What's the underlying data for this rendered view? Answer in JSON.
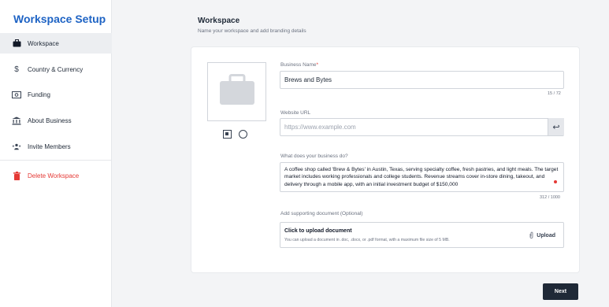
{
  "sidebar": {
    "brand": "Workspace Setup",
    "items": [
      {
        "label": "Workspace",
        "icon": "briefcase-icon"
      },
      {
        "label": "Country & Currency",
        "icon": "dollar-icon"
      },
      {
        "label": "Funding",
        "icon": "banknote-icon"
      },
      {
        "label": "About Business",
        "icon": "bank-icon"
      },
      {
        "label": "Invite Members",
        "icon": "users-icon"
      }
    ],
    "delete_label": "Delete Workspace"
  },
  "main": {
    "title": "Workspace",
    "subtitle": "Name your workspace and add branding details"
  },
  "form": {
    "business_name": {
      "label": "Business Name",
      "required_mark": "*",
      "value": "Brews and Bytes",
      "counter": "15 / 72"
    },
    "website": {
      "label": "Website URL",
      "placeholder": "https://www.example.com"
    },
    "description": {
      "label": "What does your business do?",
      "value": "A coffee shop called 'Brew & Bytes' in Austin, Texas, serving specialty coffee, fresh pastries, and light meals. The target market includes working professionals and college students. Revenue streams cover in-store dining, takeout, and delivery through a mobile app, with an initial investment budget of $150,000",
      "counter": "312 / 1000"
    },
    "document": {
      "label": "Add supporting document (Optional)",
      "title": "Click to upload document",
      "hint": "You can upload a document in .doc, .docx, or .pdf format, with a maximum file size of 5 MB.",
      "button": "Upload"
    }
  },
  "next_label": "Next",
  "colors": {
    "brand": "#1e63c4",
    "danger": "#e53935",
    "primary_button": "#1f2937"
  }
}
